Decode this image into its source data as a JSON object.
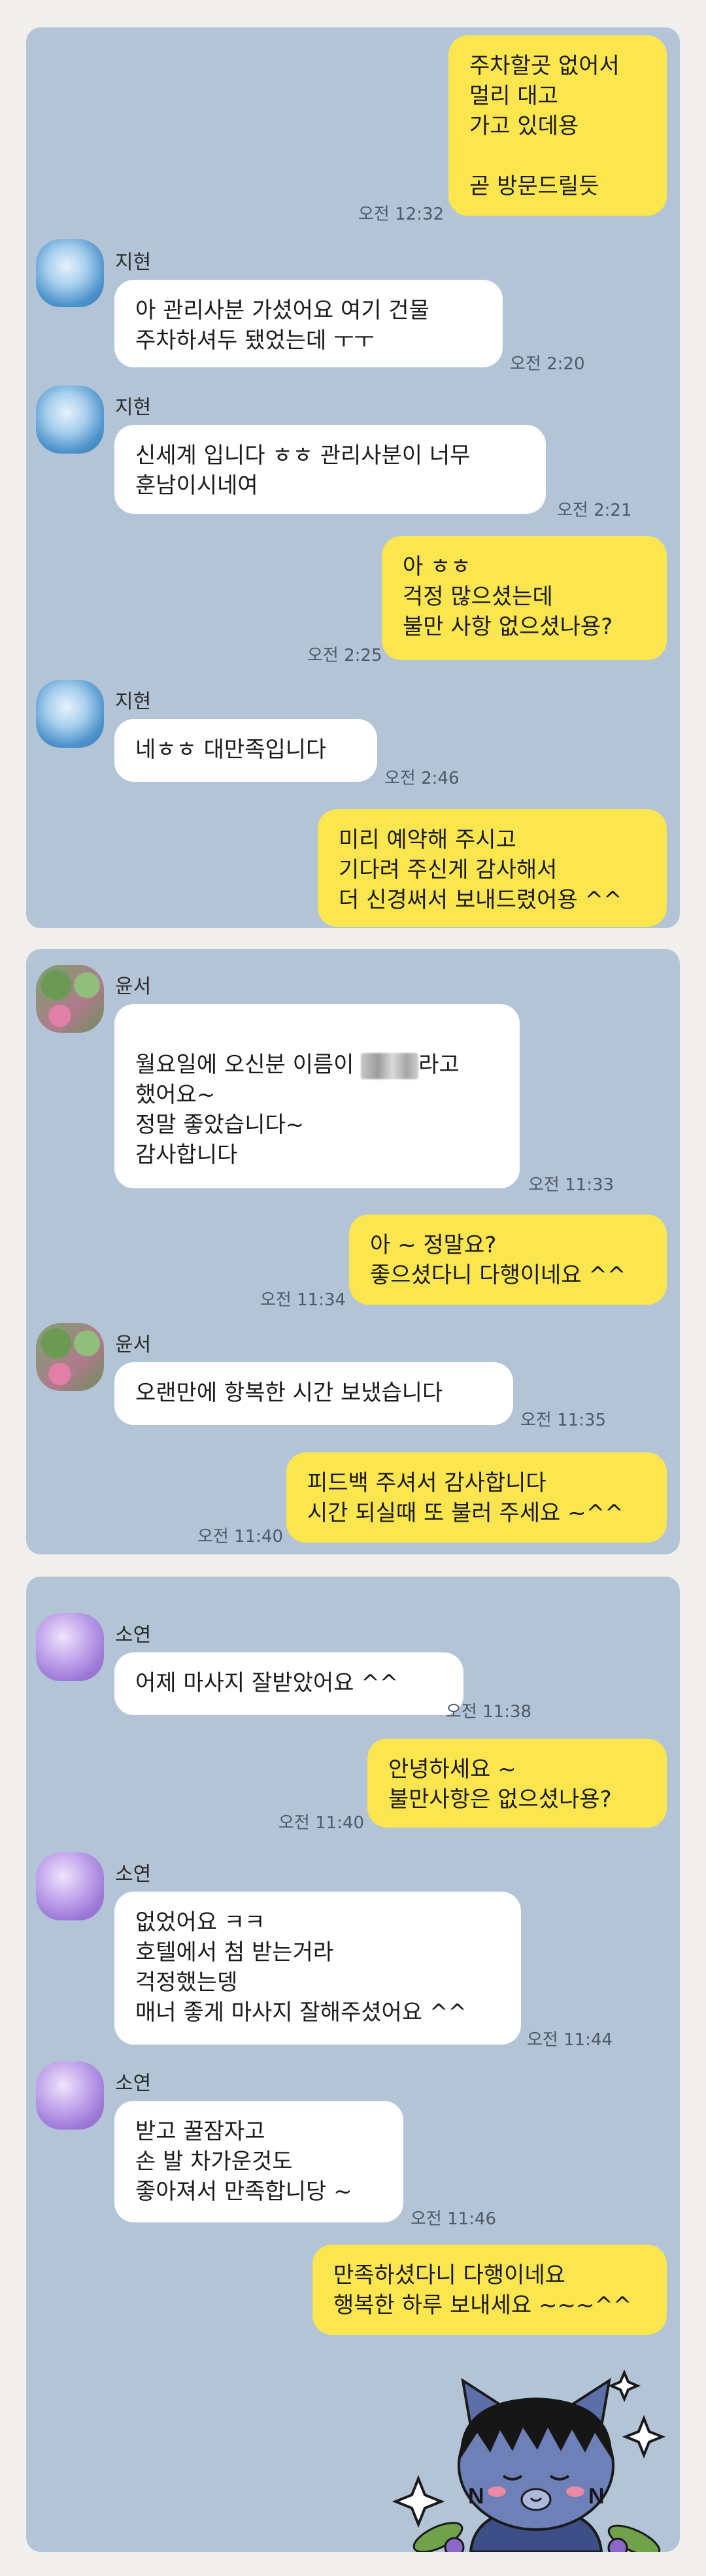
{
  "conversation1": {
    "messages": [
      {
        "text": "주차할곳 없어서\n멀리 대고\n가고 있데용\n\n곧 방문드릴듯",
        "time": "오전 12:32"
      },
      {
        "sender": "지현",
        "text": "아 관리사분 가셨어요 여기 건물\n주차하셔두 됐었는데 ㅜㅜ",
        "time": "오전 2:20"
      },
      {
        "sender": "지현",
        "text": "신세계 입니다 ㅎㅎ 관리사분이 너무\n훈남이시네여",
        "time": "오전 2:21"
      },
      {
        "text": "아 ㅎㅎ\n걱정 많으셨는데\n불만 사항 없으셨나용?",
        "time": "오전 2:25"
      },
      {
        "sender": "지현",
        "text": "네ㅎㅎ 대만족입니다",
        "time": "오전 2:46"
      },
      {
        "text": "미리 예약해 주시고\n기다려 주신게 감사해서\n더 신경써서 보내드렸어용 ^^"
      }
    ]
  },
  "conversation2": {
    "messages": [
      {
        "sender": "윤서",
        "text_before": "월요일에 오신분 이름이 ",
        "text_after": "라고\n했어요~\n정말 좋았습니다~\n감사합니다",
        "time": "오전 11:33"
      },
      {
        "text": "아 ~ 정말요?\n좋으셨다니 다행이네요 ^^",
        "time": "오전 11:34"
      },
      {
        "sender": "윤서",
        "text": "오랜만에 항복한 시간 보냈습니다",
        "time": "오전 11:35"
      },
      {
        "text": "피드백 주셔서 감사합니다\n시간 되실때 또 불러 주세요 ~^^",
        "time": "오전 11:40"
      }
    ]
  },
  "conversation3": {
    "messages": [
      {
        "sender": "소연",
        "text": "어제 마사지 잘받았어요 ^^",
        "time": "오전 11:38"
      },
      {
        "text": "안녕하세요 ~\n불만사항은 없으셨나용?",
        "time": "오전 11:40"
      },
      {
        "sender": "소연",
        "text": "없었어요 ㅋㅋ\n호텔에서 첨 받는거라\n걱정했는뎅\n매너 좋게 마사지 잘해주셨어요 ^^",
        "time": "오전 11:44"
      },
      {
        "sender": "소연",
        "text": "받고 꿀잠자고\n손 발 차가운것도\n좋아져서 만족합니당 ~",
        "time": "오전 11:46"
      },
      {
        "text": "만족하셨다니 다행이네요\n행복한 하루 보내세요 ~~~^^"
      }
    ],
    "sticker_icon": "cat-character-sticker-icon"
  },
  "colors": {
    "chat_background": "#b3c4d6",
    "outgoing_bubble": "#fbe650",
    "incoming_bubble": "#ffffff",
    "page_background": "#f1efec"
  }
}
